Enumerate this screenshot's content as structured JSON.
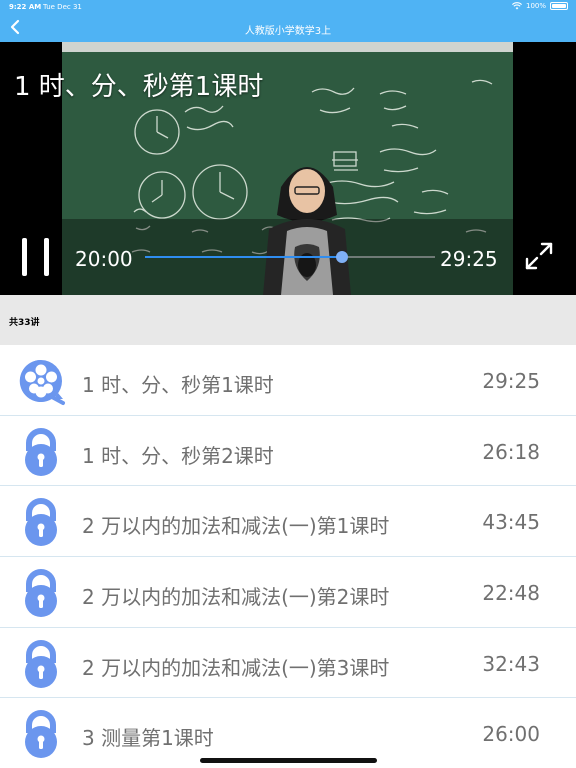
{
  "status_bar": {
    "time": "9:22 AM",
    "date": "Tue Dec 31",
    "battery": "100%"
  },
  "nav": {
    "back_icon": "chevron-left-icon",
    "title": "人教版小学数学3上"
  },
  "player": {
    "title": "1 时、分、秒第1课时",
    "current_time": "20:00",
    "total_time": "29:25",
    "progress": 0.68,
    "state": "playing",
    "pause_icon": "pause-icon",
    "fullscreen_icon": "fullscreen-icon"
  },
  "lesson_count": "共33讲",
  "lessons": [
    {
      "title": "1 时、分、秒第1课时",
      "duration": "29:25",
      "icon": "film-reel-icon",
      "locked": false
    },
    {
      "title": "1 时、分、秒第2课时",
      "duration": "26:18",
      "icon": "lock-icon",
      "locked": true
    },
    {
      "title": "2 万以内的加法和减法(一)第1课时",
      "duration": "43:45",
      "icon": "lock-icon",
      "locked": true
    },
    {
      "title": "2 万以内的加法和减法(一)第2课时",
      "duration": "22:48",
      "icon": "lock-icon",
      "locked": true
    },
    {
      "title": "2 万以内的加法和减法(一)第3课时",
      "duration": "32:43",
      "icon": "lock-icon",
      "locked": true
    },
    {
      "title": "3 测量第1课时",
      "duration": "26:00",
      "icon": "lock-icon",
      "locked": true
    }
  ],
  "colors": {
    "nav_bg": "#4fb3f4",
    "icon_blue": "#6b96ee",
    "progress_fill": "#2f8df0",
    "list_text": "#707070"
  }
}
